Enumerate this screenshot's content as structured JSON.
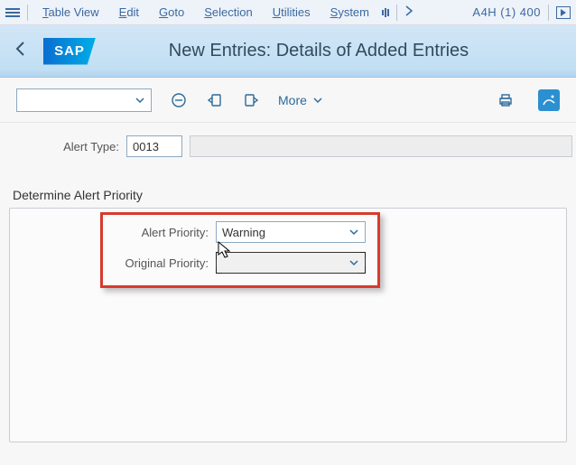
{
  "menubar": {
    "items": [
      {
        "letter": "T",
        "rest": "able View"
      },
      {
        "letter": "E",
        "rest": "dit"
      },
      {
        "letter": "G",
        "rest": "oto"
      },
      {
        "letter": "S",
        "rest": "election"
      },
      {
        "letter": "U",
        "rest": "tilities"
      },
      {
        "letter": "S",
        "rest": "ystem"
      }
    ],
    "system": "A4H (1) 400"
  },
  "header": {
    "logo": "SAP",
    "title": "New Entries: Details of Added Entries"
  },
  "toolbar": {
    "more_label": "More"
  },
  "form": {
    "alert_type_label": "Alert Type:",
    "alert_type_value": "0013",
    "section_title": "Determine Alert Priority",
    "alert_priority_label": "Alert Priority:",
    "alert_priority_value": "Warning",
    "original_priority_label": "Original Priority:",
    "original_priority_value": ""
  },
  "colors": {
    "highlight": "#d73a2e",
    "accent": "#2c6a9a"
  }
}
